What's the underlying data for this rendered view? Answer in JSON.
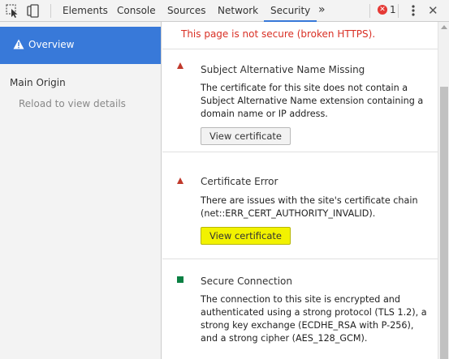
{
  "toolbar": {
    "tabs": [
      {
        "label": "Elements"
      },
      {
        "label": "Console"
      },
      {
        "label": "Sources"
      },
      {
        "label": "Network"
      },
      {
        "label": "Security"
      }
    ],
    "more_glyph": "»",
    "error_count": "1",
    "error_glyph": "✕",
    "close_glyph": "✕",
    "icons": [
      "inspect-element-icon",
      "device-toolbar-icon",
      "error-icon",
      "more-menu-icon",
      "close-icon"
    ],
    "accent_color": "#3879d9"
  },
  "sidebar": {
    "overview_label": "Overview",
    "main_origin_label": "Main Origin",
    "reload_label": "Reload to view details"
  },
  "main": {
    "banner_text": "This page is not secure (broken HTTPS).",
    "cards": [
      {
        "title": "Subject Alternative Name Missing",
        "description": "The certificate for this site does not contain a Subject Alternative Name extension containing a domain name or IP address.",
        "button_label": "View certificate",
        "status": "error"
      },
      {
        "title": "Certificate Error",
        "description": "There are issues with the site's certificate chain (net::ERR_CERT_AUTHORITY_INVALID).",
        "button_label": "View certificate",
        "status": "error"
      },
      {
        "title": "Secure Connection",
        "description": "The connection to this site is encrypted and authenticated using a strong protocol (TLS 1.2), a strong key exchange (ECDHE_RSA with P-256), and a strong cipher (AES_128_GCM).",
        "status": "secure"
      }
    ],
    "colors": {
      "error": "#c0392b",
      "secure": "#0b8043",
      "banner_text": "#d93025",
      "highlight": "#f2f200"
    }
  }
}
